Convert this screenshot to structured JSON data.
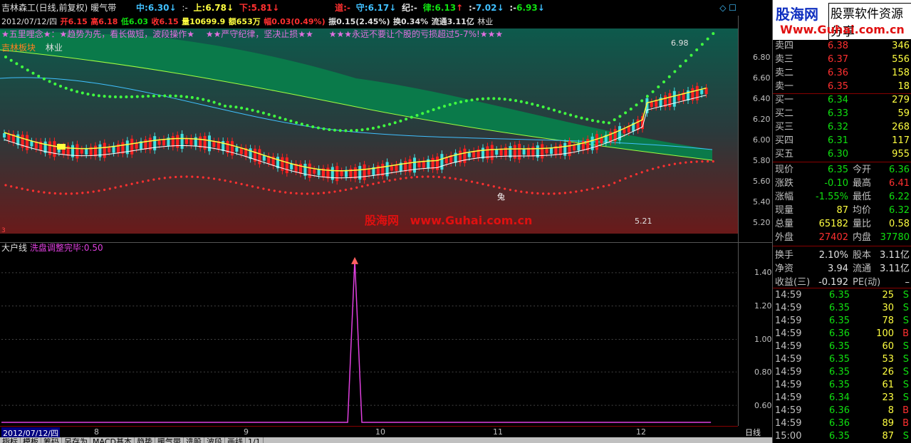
{
  "header": {
    "stock": "吉林森工(日线,前复权)",
    "indicator": "暖气带",
    "zhong_label": "中:",
    "zhong": "6.30",
    "zhong_arrow": "↓",
    "dash1": ":-",
    "shang_label": "上:",
    "shang": "6.78",
    "shang_arrow": "↓",
    "xia_label": "下:",
    "xia": "5.81",
    "xia_arrow": "↓",
    "dao_label": "道:",
    "dao": "-",
    "shou_label": "守:",
    "shou": "6.17",
    "shou_arrow": "↓",
    "ji_label": "纪:",
    "ji": "-",
    "lv_label": "律:",
    "lv": "6.13",
    "lv_arrow": "↑",
    "dash2": ":-",
    "v2": "7.02",
    "v2_arrow": "↓",
    "dash3": ":-",
    "v3": "6.93",
    "v3_arrow": "↓",
    "corner_icons": "◇ ☐"
  },
  "info": {
    "date": "2012/07/12/四",
    "open_label": "开",
    "open": "6.15",
    "high_label": "高",
    "high": "6.18",
    "low_label": "低",
    "low": "6.03",
    "close_label": "收",
    "close": "6.15",
    "vol_label": "量",
    "vol": "10699.9",
    "amt_label": "额",
    "amt": "653万",
    "chg_label": "幅",
    "chg": "0.03(0.49%)",
    "amp_label": "振",
    "amp": "0.15(2.45%)",
    "turn_label": "换",
    "turn": "0.34%",
    "float_label": "流通",
    "float": "3.11亿",
    "sector": "林业"
  },
  "slogans": {
    "s1": "★五里哩念★：★趋势为先，看长做短，波段操作★",
    "s2": "★★严守纪律，坚决止损★★",
    "s3": "★★★永远不要让个股的亏损超过5-7%!★★★"
  },
  "sector_tags": {
    "board": "吉林板块",
    "industry": "林业"
  },
  "annotations": {
    "high_mark": "6.98",
    "low_mark": "5.21",
    "rabbit": "兔",
    "m3": "3"
  },
  "watermark": {
    "cn": "股海网",
    "url": "www.Guhai.com.cn"
  },
  "price_axis": [
    "6.80",
    "6.60",
    "6.40",
    "6.20",
    "6.00",
    "5.80",
    "5.60",
    "5.40",
    "5.20"
  ],
  "sub": {
    "name": "大户线",
    "line_label": "洗盘调整完毕:",
    "line_value": "0.50",
    "axis": [
      "1.40",
      "1.20",
      "1.00",
      "0.80",
      "0.60"
    ]
  },
  "date_axis": {
    "current": "2012/07/12/四",
    "months": [
      "8",
      "9",
      "10",
      "11",
      "12"
    ],
    "period": "日线"
  },
  "tabs": [
    "指标",
    "模板",
    "筹码",
    "另存为",
    "MACD基本",
    "趋势",
    "暖气带",
    "选股",
    "波段",
    "画线",
    "1/1"
  ],
  "logo": {
    "l1": "股海网",
    "l1b": "股票软件资源分享",
    "l2": "Www.Guhai.com.cn"
  },
  "orderbook": [
    {
      "label": "卖四",
      "price": "6.38",
      "vol": "346"
    },
    {
      "label": "卖三",
      "price": "6.37",
      "vol": "556"
    },
    {
      "label": "卖二",
      "price": "6.36",
      "vol": "158"
    },
    {
      "label": "卖一",
      "price": "6.35",
      "vol": "18"
    },
    {
      "label": "买一",
      "price": "6.34",
      "vol": "279"
    },
    {
      "label": "买二",
      "price": "6.33",
      "vol": "59"
    },
    {
      "label": "买三",
      "price": "6.32",
      "vol": "268"
    },
    {
      "label": "买四",
      "price": "6.31",
      "vol": "117"
    },
    {
      "label": "买五",
      "price": "6.30",
      "vol": "955"
    }
  ],
  "quote": {
    "r1": {
      "a": "现价",
      "b": "6.35",
      "c": "今开",
      "e": "6.36"
    },
    "r2": {
      "a": "涨跌",
      "b": "-0.10",
      "c": "最高",
      "e": "6.41"
    },
    "r3": {
      "a": "涨幅",
      "b": "-1.55%",
      "c": "最低",
      "e": "6.22"
    },
    "r4": {
      "a": "现量",
      "b": "87",
      "c": "均价",
      "e": "6.32"
    },
    "r5": {
      "a": "总量",
      "b": "65182",
      "c": "量比",
      "e": "0.58"
    },
    "r6": {
      "a": "外盘",
      "b": "27402",
      "c": "内盘",
      "e": "37780"
    },
    "r7": {
      "a": "换手",
      "b": "2.10%",
      "c": "股本",
      "e": "3.11亿"
    },
    "r8": {
      "a": "净资",
      "b": "3.94",
      "c": "流通",
      "e": "3.11亿"
    },
    "r9": {
      "a": "收益(三)",
      "b": "-0.192",
      "c": "PE(动)",
      "e": "–"
    }
  },
  "ticks": [
    {
      "t": "14:59",
      "p": "6.35",
      "v": "25",
      "s": "S"
    },
    {
      "t": "14:59",
      "p": "6.35",
      "v": "30",
      "s": "S"
    },
    {
      "t": "14:59",
      "p": "6.35",
      "v": "78",
      "s": "S"
    },
    {
      "t": "14:59",
      "p": "6.36",
      "v": "100",
      "s": "B"
    },
    {
      "t": "14:59",
      "p": "6.35",
      "v": "60",
      "s": "S"
    },
    {
      "t": "14:59",
      "p": "6.35",
      "v": "53",
      "s": "S"
    },
    {
      "t": "14:59",
      "p": "6.35",
      "v": "26",
      "s": "S"
    },
    {
      "t": "14:59",
      "p": "6.35",
      "v": "61",
      "s": "S"
    },
    {
      "t": "14:59",
      "p": "6.34",
      "v": "23",
      "s": "S"
    },
    {
      "t": "14:59",
      "p": "6.36",
      "v": "8",
      "s": "B"
    },
    {
      "t": "14:59",
      "p": "6.36",
      "v": "89",
      "s": "B"
    },
    {
      "t": "15:00",
      "p": "6.35",
      "v": "87",
      "s": "S"
    }
  ],
  "colors": {
    "up": "#ff3030",
    "down": "#10e010",
    "neutral": "#e0e0e0",
    "ribbon": "#0a7a4a",
    "candle_down": "#40e0e0"
  }
}
